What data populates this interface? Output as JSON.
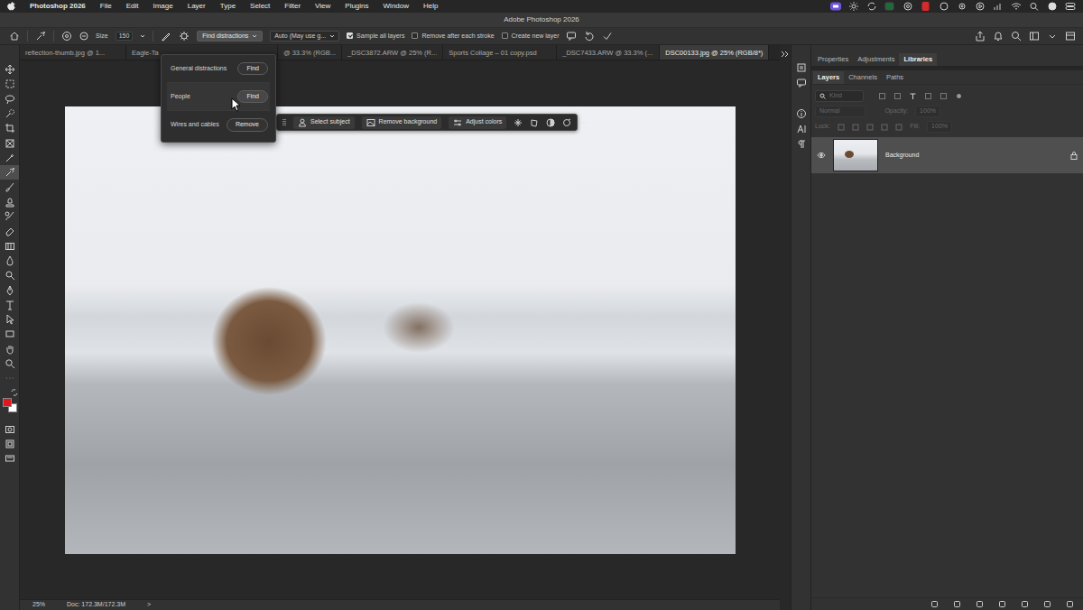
{
  "menubar": {
    "app": "Photoshop 2026",
    "items": [
      "File",
      "Edit",
      "Image",
      "Layer",
      "Type",
      "Select",
      "Filter",
      "View",
      "Plugins",
      "Window",
      "Help"
    ]
  },
  "window": {
    "title": "Adobe Photoshop 2026"
  },
  "options_bar": {
    "size_label": "Size",
    "size_value": "150",
    "find_button": "Find distractions",
    "find_open": true,
    "mode": "Auto (May use g...",
    "checks": [
      {
        "label": "Sample all layers",
        "checked": true
      },
      {
        "label": "Remove after each stroke",
        "checked": false
      },
      {
        "label": "Create new layer",
        "checked": false
      }
    ]
  },
  "tools": [
    {
      "selected": false
    },
    {
      "selected": false
    },
    {
      "selected": false
    },
    {
      "selected": false
    },
    {
      "selected": false
    },
    {
      "selected": false
    },
    {
      "selected": false
    },
    {
      "selected": true
    },
    {
      "selected": false
    },
    {
      "selected": false
    },
    {
      "selected": false
    },
    {
      "selected": false
    },
    {
      "selected": false
    },
    {
      "selected": false
    },
    {
      "selected": false
    },
    {
      "selected": false
    },
    {
      "selected": false
    },
    {
      "selected": false
    },
    {
      "selected": false
    },
    {
      "selected": false
    },
    {
      "selected": false
    },
    {
      "selected": false
    },
    {
      "selected": false
    },
    {
      "selected": false
    },
    {
      "selected": false
    }
  ],
  "colors": {
    "foreground": "#e3161d",
    "background": "#ffffff"
  },
  "tabs": [
    {
      "label": "reflection-thumb.jpg @ 1...",
      "selected": false
    },
    {
      "label": "Eagle-Ta",
      "selected": false
    },
    {
      "label": "@ 33.3% (RGB...",
      "selected": false
    },
    {
      "label": "_DSC3872.ARW @ 25% (R...",
      "selected": false
    },
    {
      "label": "Sports Collage – 01 copy.psd",
      "selected": false
    },
    {
      "label": "_DSC7433.ARW @ 33.3% (...",
      "selected": false
    },
    {
      "label": "DSC00133.jpg @ 25% (RGB/8*)",
      "selected": true
    }
  ],
  "distractions_menu": {
    "open": true,
    "items": [
      {
        "label": "General distractions",
        "action": "Find",
        "hovered": false
      },
      {
        "label": "People",
        "action": "Find",
        "hovered": true
      },
      {
        "label": "Wires and cables",
        "action": "Remove",
        "hovered": false
      }
    ]
  },
  "taskbar": {
    "buttons": [
      "Select subject",
      "Remove background",
      "Adjust colors"
    ]
  },
  "status_bar": {
    "zoom": "25%",
    "doc": "Doc: 172.3M/172.3M",
    "arrow": ">"
  },
  "panel_tabs": [
    {
      "label": "Properties",
      "selected": false
    },
    {
      "label": "Adjustments",
      "selected": false
    },
    {
      "label": "Libraries",
      "selected": true
    }
  ],
  "layer_tabs": [
    {
      "label": "Layers",
      "selected": true
    },
    {
      "label": "Channels",
      "selected": false
    },
    {
      "label": "Paths",
      "selected": false
    }
  ],
  "layers_panel": {
    "filter_kind": "Kind",
    "blend_mode": "Normal",
    "opacity_label": "Opacity:",
    "opacity": "100%",
    "lock_label": "Lock:",
    "fill_label": "Fill:",
    "fill": "100%",
    "controls_disabled": true
  },
  "layers": [
    {
      "name": "Background",
      "visible": true,
      "locked": true,
      "selected": true
    }
  ]
}
